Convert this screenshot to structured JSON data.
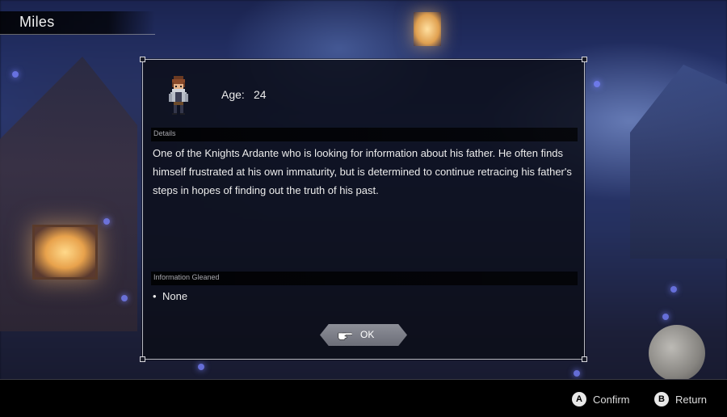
{
  "character": {
    "name": "Miles"
  },
  "profile": {
    "age_label": "Age:",
    "age_value": "24"
  },
  "details": {
    "section_label": "Details",
    "text": "One of the Knights Ardante who is looking for information about his father. He often finds himself frustrated at his own immaturity, but is determined to continue retracing his father's steps in hopes of finding out the truth of his past."
  },
  "information": {
    "section_label": "Information Gleaned",
    "items": [
      "None"
    ]
  },
  "dialog": {
    "ok_label": "OK",
    "ok_icon": "pointing-hand-icon"
  },
  "hints": {
    "confirm": {
      "button": "A",
      "label": "Confirm"
    },
    "return": {
      "button": "B",
      "label": "Return"
    }
  },
  "colors": {
    "dialog_bg": "#0c0e18",
    "dialog_border": "#b9bac2",
    "text": "#ececec",
    "section_label": "#a7a7ad",
    "ok_button": "#7c7e88"
  }
}
